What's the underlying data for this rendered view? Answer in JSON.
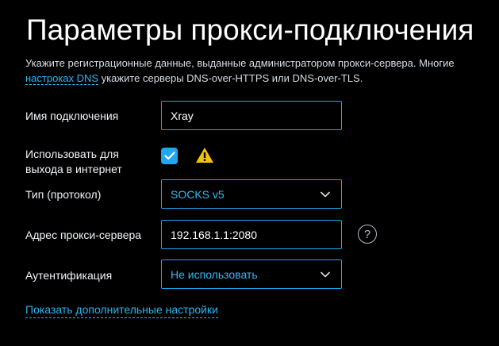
{
  "page": {
    "title": "Параметры прокси-подключения",
    "description_line1": "Укажите регистрационные данные, выданные администратором прокси-сервера. Многие",
    "description_link": "настроках DNS",
    "description_line2_rest": " укажите серверы DNS-over-HTTPS или DNS-over-TLS."
  },
  "form": {
    "connection_name": {
      "label": "Имя подключения",
      "value": "Xray"
    },
    "internet_access": {
      "label_line1": "Использовать для",
      "label_line2": "выхода в интернет",
      "checked": true,
      "warning_icon": "warning-triangle-icon"
    },
    "protocol": {
      "label": "Тип (протокол)",
      "value": "SOCKS v5",
      "icon": "chevron-down-icon"
    },
    "server_address": {
      "label": "Адрес прокси-сервера",
      "value": "192.168.1.1:2080",
      "help_icon": "question-mark-icon",
      "help_text": "?"
    },
    "authentication": {
      "label": "Аутентификация",
      "value": "Не использовать",
      "icon": "chevron-down-icon"
    }
  },
  "footer": {
    "advanced_link": "Показать дополнительные настройки"
  },
  "colors": {
    "background": "#000000",
    "accent": "#1ea8ef",
    "link": "#28b6f6",
    "warning": "#f5c400",
    "text": "#ffffff",
    "muted_text": "#d7dde3"
  }
}
